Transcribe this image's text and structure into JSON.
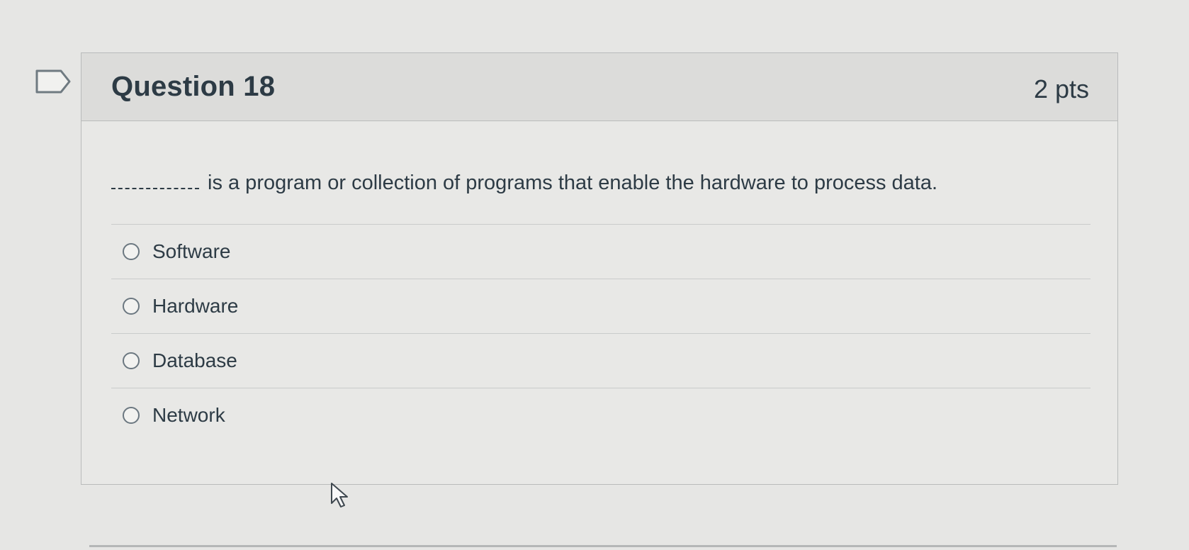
{
  "question": {
    "title": "Question 18",
    "points": "2 pts",
    "text": "is a program or collection of programs that enable the hardware to process data.",
    "blank_icon": "fill-in-blank"
  },
  "answers": [
    {
      "label": "Software"
    },
    {
      "label": "Hardware"
    },
    {
      "label": "Database"
    },
    {
      "label": "Network"
    }
  ],
  "icons": {
    "flag": "flag-question-icon",
    "cursor": "mouse-pointer-icon"
  },
  "colors": {
    "text": "#2d3b45",
    "header_bg": "#dcdcda",
    "border": "#b9bbbb"
  }
}
